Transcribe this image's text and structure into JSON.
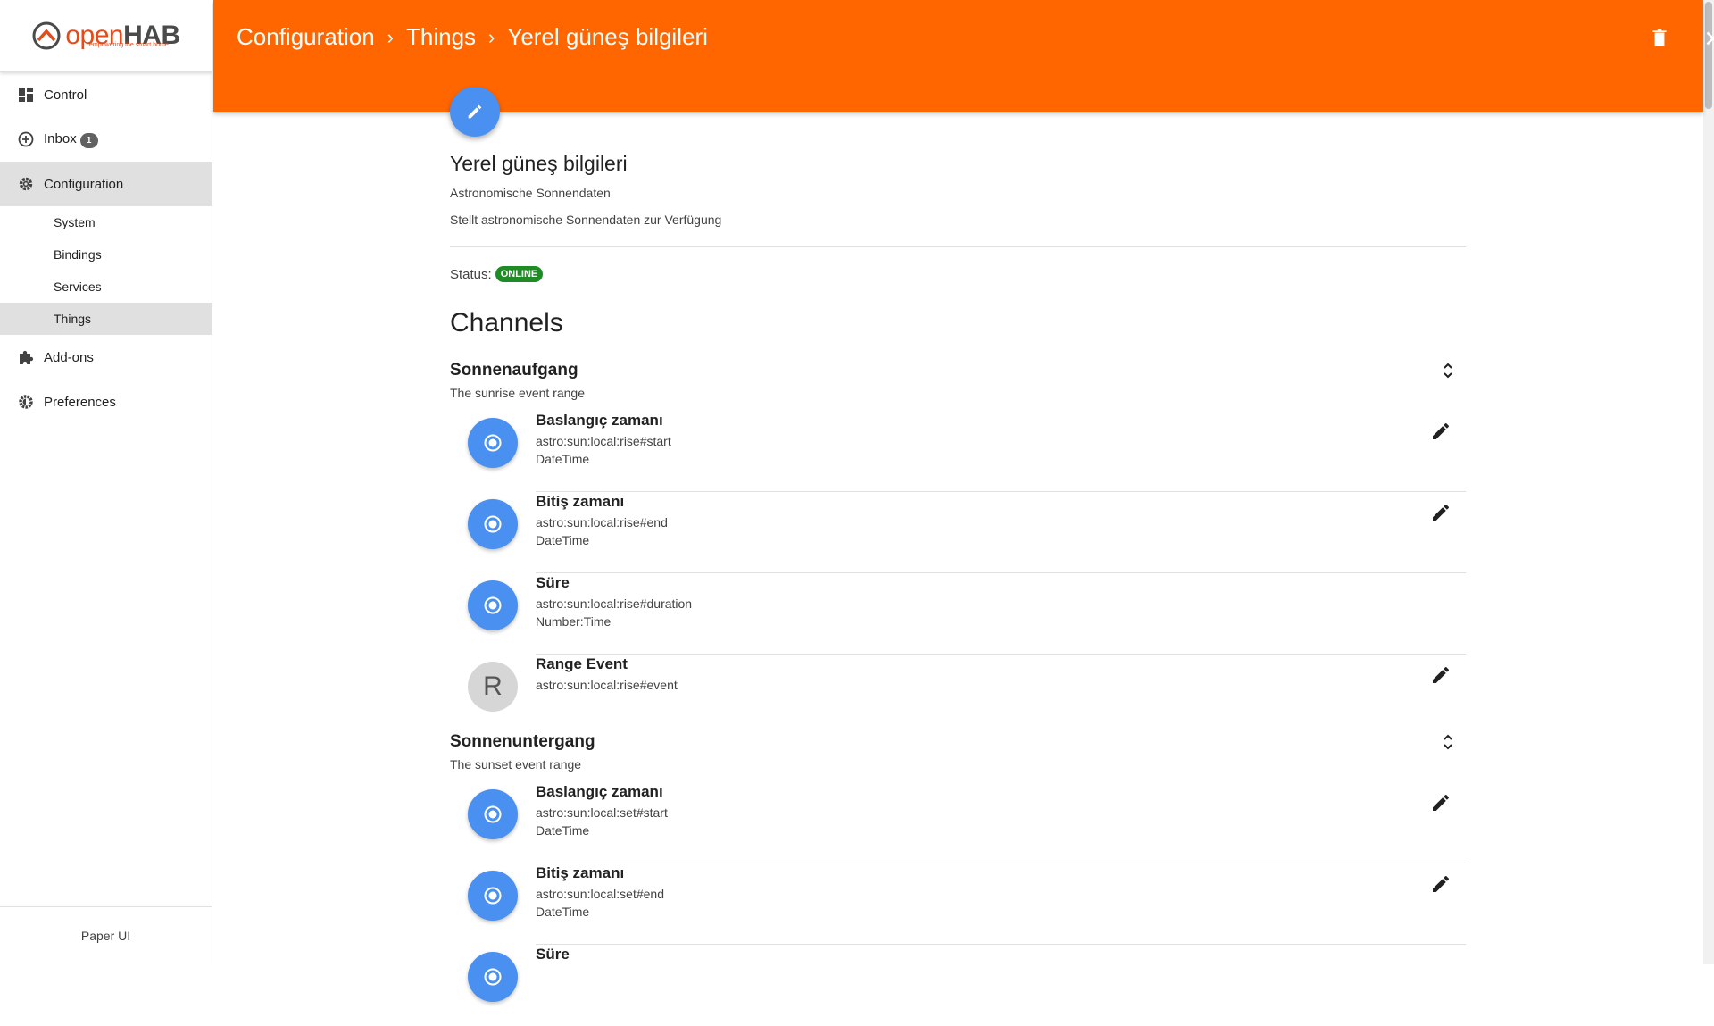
{
  "app": {
    "logo_main": "open",
    "logo_bold": "HAB",
    "logo_tagline": "empowering the smart home"
  },
  "sidebar": {
    "items": [
      {
        "label": "Control"
      },
      {
        "label": "Inbox",
        "badge": "1"
      },
      {
        "label": "Configuration"
      },
      {
        "label": "Add-ons"
      },
      {
        "label": "Preferences"
      }
    ],
    "config_sub": [
      {
        "label": "System"
      },
      {
        "label": "Bindings"
      },
      {
        "label": "Services"
      },
      {
        "label": "Things"
      }
    ],
    "footer": "Paper UI"
  },
  "header": {
    "breadcrumb": [
      "Configuration",
      "Things",
      "Yerel güneş bilgileri"
    ],
    "separator": "›"
  },
  "thing": {
    "title": "Yerel güneş bilgileri",
    "subtitle": "Astronomische Sonnendaten",
    "description": "Stellt astronomische Sonnendaten zur Verfügung",
    "status_label": "Status:",
    "status": "ONLINE",
    "status_color": "#1f8b24"
  },
  "channels": {
    "title": "Channels",
    "groups": [
      {
        "title": "Sonnenaufgang",
        "description": "The sunrise event range",
        "items": [
          {
            "name": "Baslangıç zamanı",
            "uid": "astro:sun:local:rise#start",
            "type": "DateTime",
            "avatar": "",
            "editable": true
          },
          {
            "name": "Bitiş zamanı",
            "uid": "astro:sun:local:rise#end",
            "type": "DateTime",
            "avatar": "",
            "editable": true
          },
          {
            "name": "Süre",
            "uid": "astro:sun:local:rise#duration",
            "type": "Number:Time",
            "avatar": "",
            "editable": false
          },
          {
            "name": "Range Event",
            "uid": "astro:sun:local:rise#event",
            "type": "",
            "avatar": "R",
            "editable": true
          }
        ]
      },
      {
        "title": "Sonnenuntergang",
        "description": "The sunset event range",
        "items": [
          {
            "name": "Baslangıç zamanı",
            "uid": "astro:sun:local:set#start",
            "type": "DateTime",
            "avatar": "",
            "editable": true
          },
          {
            "name": "Bitiş zamanı",
            "uid": "astro:sun:local:set#end",
            "type": "DateTime",
            "avatar": "",
            "editable": true
          },
          {
            "name": "Süre",
            "uid": "",
            "type": "",
            "avatar": "",
            "editable": false
          }
        ]
      }
    ]
  },
  "colors": {
    "header": "#ff6600",
    "accent": "#4a90f0"
  }
}
